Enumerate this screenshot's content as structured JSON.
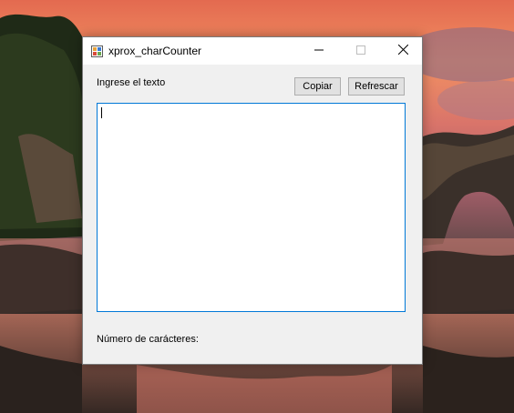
{
  "window": {
    "title": "xprox_charCounter"
  },
  "main": {
    "input_label": "Ingrese el texto",
    "copy_button": "Copiar",
    "refresh_button": "Refrescar",
    "text_value": "",
    "count_label": "Número de carácteres:"
  },
  "icons": {
    "app": "app-icon",
    "minimize": "minimize-icon",
    "maximize": "maximize-icon",
    "close": "close-icon"
  },
  "colors": {
    "focus_border": "#0078d7",
    "window_bg": "#f0f0f0",
    "button_bg": "#e1e1e1"
  }
}
